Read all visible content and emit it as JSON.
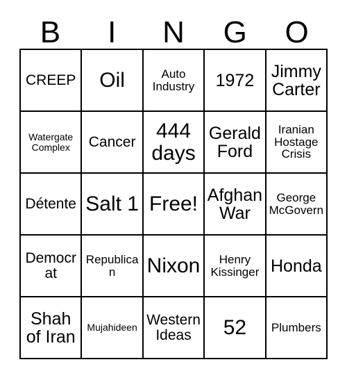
{
  "card": {
    "header_letters": [
      "B",
      "I",
      "N",
      "G",
      "O"
    ],
    "rows": [
      [
        {
          "text": "CREEP",
          "size": "md"
        },
        {
          "text": "Oil",
          "size": "xl"
        },
        {
          "text": "Auto Industry",
          "size": "sm"
        },
        {
          "text": "1972",
          "size": "lg"
        },
        {
          "text": "Jimmy Carter",
          "size": "lg"
        }
      ],
      [
        {
          "text": "Watergate Complex",
          "size": "xs"
        },
        {
          "text": "Cancer",
          "size": "md"
        },
        {
          "text": "444 days",
          "size": "xl"
        },
        {
          "text": "Gerald Ford",
          "size": "lg"
        },
        {
          "text": "Iranian Hostage Crisis",
          "size": "sm"
        }
      ],
      [
        {
          "text": "Détente",
          "size": "md"
        },
        {
          "text": "Salt 1",
          "size": "xl"
        },
        {
          "text": "Free!",
          "size": "xl"
        },
        {
          "text": "Afghan War",
          "size": "lg"
        },
        {
          "text": "George McGovern",
          "size": "sm"
        }
      ],
      [
        {
          "text": "Democrat",
          "size": "md"
        },
        {
          "text": "Republican",
          "size": "sm"
        },
        {
          "text": "Nixon",
          "size": "xl"
        },
        {
          "text": "Henry Kissinger",
          "size": "sm"
        },
        {
          "text": "Honda",
          "size": "lg"
        }
      ],
      [
        {
          "text": "Shah of Iran",
          "size": "lg"
        },
        {
          "text": "Mujahideen",
          "size": "xs"
        },
        {
          "text": "Western Ideas",
          "size": "md"
        },
        {
          "text": "52",
          "size": "xl"
        },
        {
          "text": "Plumbers",
          "size": "sm"
        }
      ]
    ],
    "colors": {
      "border": "#000000",
      "cell_background": "#ffffff",
      "text": "#000000"
    }
  }
}
